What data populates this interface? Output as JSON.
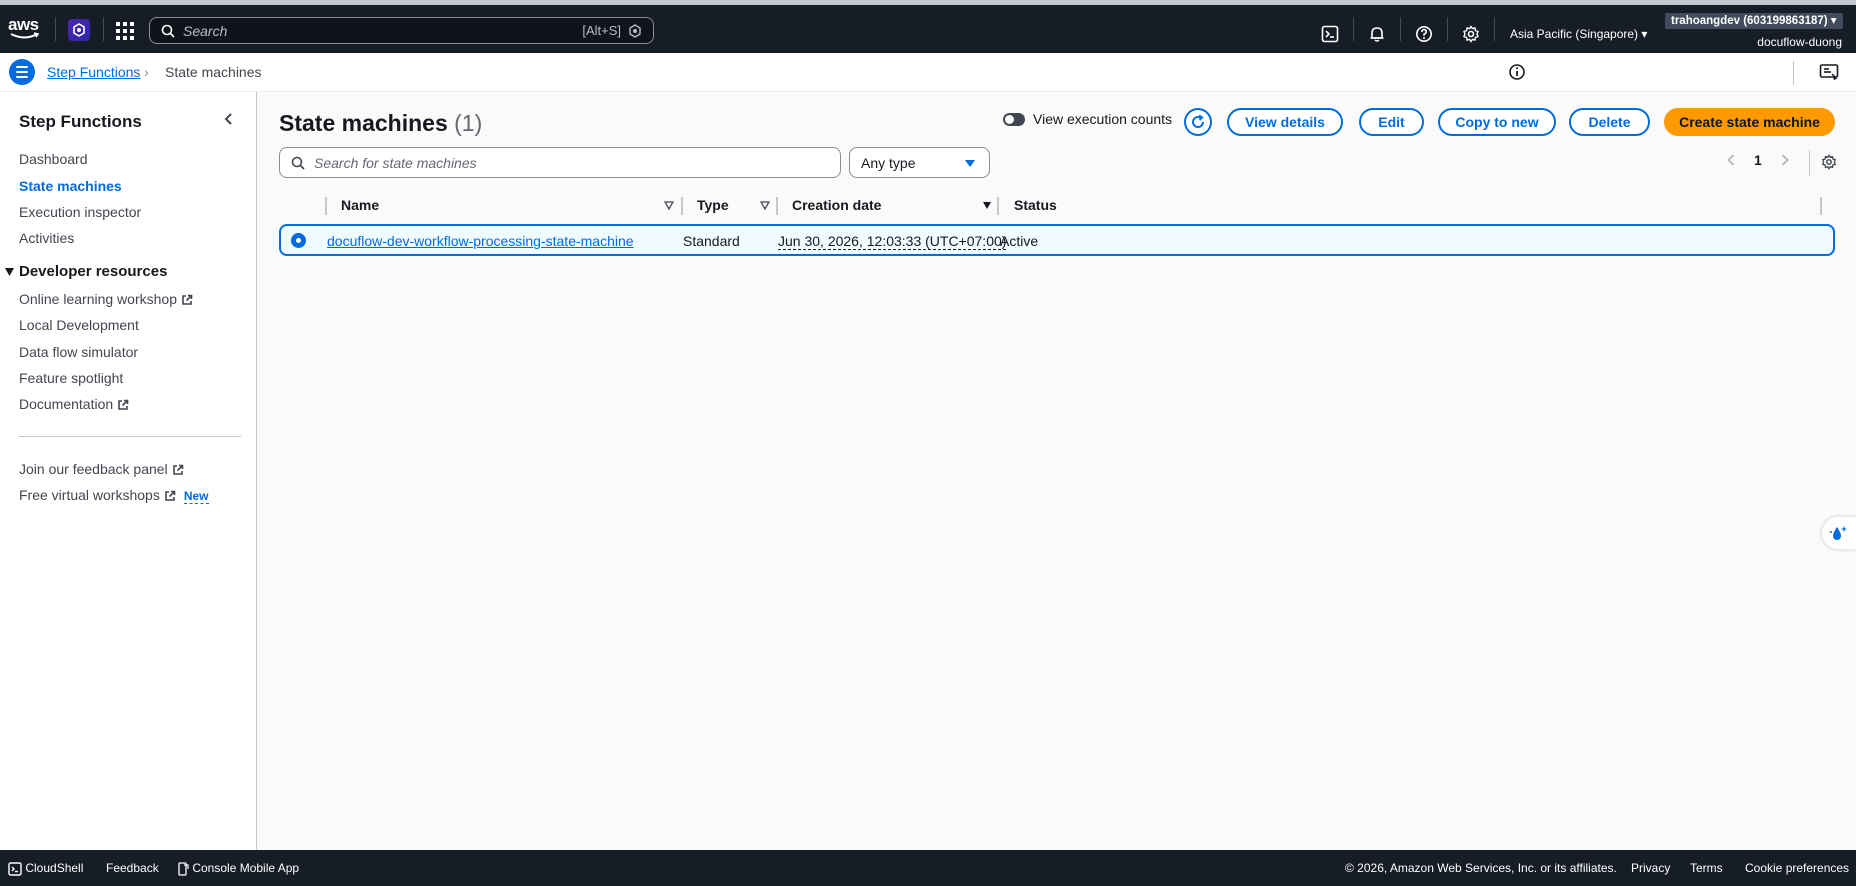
{
  "top_nav": {
    "logo_text": "aws",
    "search_placeholder": "Search",
    "search_shortcut": "[Alt+S]",
    "region": "Asia Pacific (Singapore) ▾",
    "account": "trahoangdev (603199863187) ▾",
    "user": "docuflow-duong"
  },
  "breadcrumb": {
    "parent": "Step Functions",
    "separator": "›",
    "current": "State machines"
  },
  "sidebar": {
    "title": "Step Functions",
    "items": [
      {
        "label": "Dashboard"
      },
      {
        "label": "State machines"
      },
      {
        "label": "Execution inspector"
      },
      {
        "label": "Activities"
      }
    ],
    "section_title": "Developer resources",
    "section_items": [
      {
        "label": "Online learning workshop"
      },
      {
        "label": "Local Development"
      },
      {
        "label": "Data flow simulator"
      },
      {
        "label": "Feature spotlight"
      },
      {
        "label": "Documentation"
      }
    ],
    "extra_items": [
      {
        "label": "Join our feedback panel"
      },
      {
        "label": "Free virtual workshops",
        "badge": "New"
      }
    ]
  },
  "main": {
    "title": "State machines",
    "count": "(1)",
    "toggle_label": "View execution counts",
    "buttons": {
      "view_details": "View details",
      "edit": "Edit",
      "copy": "Copy to new",
      "delete": "Delete",
      "create": "Create state machine"
    },
    "filter_placeholder": "Search for state machines",
    "type_filter": "Any type",
    "page": "1",
    "columns": [
      "Name",
      "Type",
      "Creation date",
      "Status"
    ],
    "rows": [
      {
        "name": "docuflow-dev-workflow-processing-state-machine",
        "type": "Standard",
        "created": "Jun 30, 2026, 12:03:33 (UTC+07:00)",
        "status": "Active"
      }
    ]
  },
  "footer": {
    "cloudshell": "CloudShell",
    "feedback": "Feedback",
    "mobile": "Console Mobile App",
    "copyright": "© 2026, Amazon Web Services, Inc. or its affiliates.",
    "privacy": "Privacy",
    "terms": "Terms",
    "cookies": "Cookie preferences"
  },
  "colors": {
    "nav_bg": "#161d26",
    "link_blue": "#006ce0",
    "primary_orange": "#ff9900",
    "selected_row_bg": "#f0fbff"
  }
}
